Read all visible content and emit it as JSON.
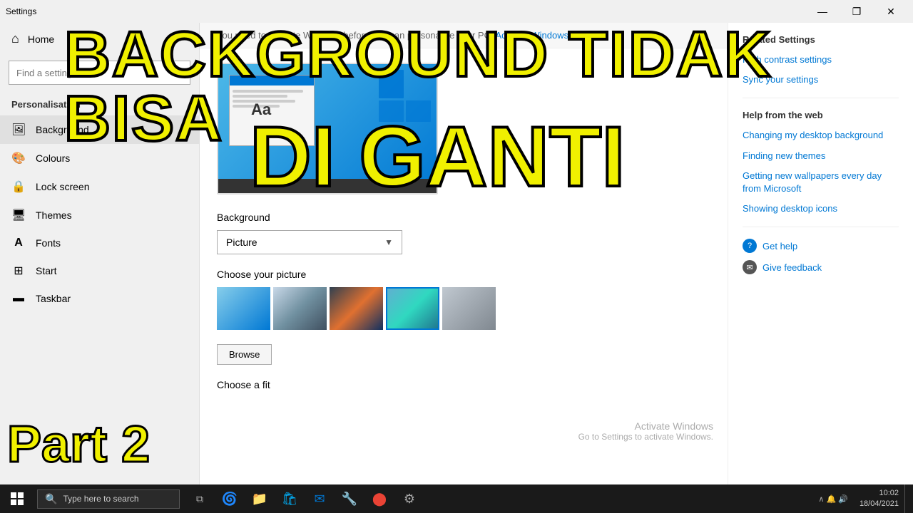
{
  "titlebar": {
    "title": "Settings",
    "minimize": "—",
    "maximize": "❐",
    "close": "✕"
  },
  "sidebar": {
    "home_label": "Home",
    "search_placeholder": "Find a setting",
    "personalisation_header": "Personalisation",
    "nav_items": [
      {
        "id": "background",
        "label": "Background",
        "icon": "🖼"
      },
      {
        "id": "colours",
        "label": "Colours",
        "icon": "🎨"
      },
      {
        "id": "lock-screen",
        "label": "Lock screen",
        "icon": "🔒"
      },
      {
        "id": "themes",
        "label": "Themes",
        "icon": "🖥"
      },
      {
        "id": "fonts",
        "label": "Fonts",
        "icon": "A"
      },
      {
        "id": "start",
        "label": "Start",
        "icon": "⊞"
      },
      {
        "id": "taskbar",
        "label": "Taskbar",
        "icon": "▬"
      }
    ]
  },
  "main": {
    "activation_text": "You need to activate Windows before you can personalise your PC.",
    "activation_link": "Activate Windows now.",
    "background_label": "Background",
    "dropdown_value": "Picture",
    "choose_picture_label": "Choose your picture",
    "browse_label": "Browse",
    "choose_fit_label": "Choose a fit"
  },
  "right_panel": {
    "related_settings_title": "Related Settings",
    "links": [
      "High contrast settings",
      "Sync your settings"
    ],
    "help_title": "Help from the web",
    "help_links": [
      "Changing my desktop background",
      "Finding new themes",
      "Getting new wallpapers every day from Microsoft",
      "Showing desktop icons"
    ],
    "get_help_label": "Get help",
    "give_feedback_label": "Give feedback",
    "activate_title": "Activate Windows",
    "activate_sub": "Go to Settings to activate Windows."
  },
  "overlay": {
    "line1": "BACKGROUND TIDAK BISA",
    "line2": "DI GANTI",
    "part2": "Part 2"
  },
  "taskbar": {
    "search_placeholder": "Type here to search",
    "time": "10:02",
    "date": "18/04/2021"
  }
}
